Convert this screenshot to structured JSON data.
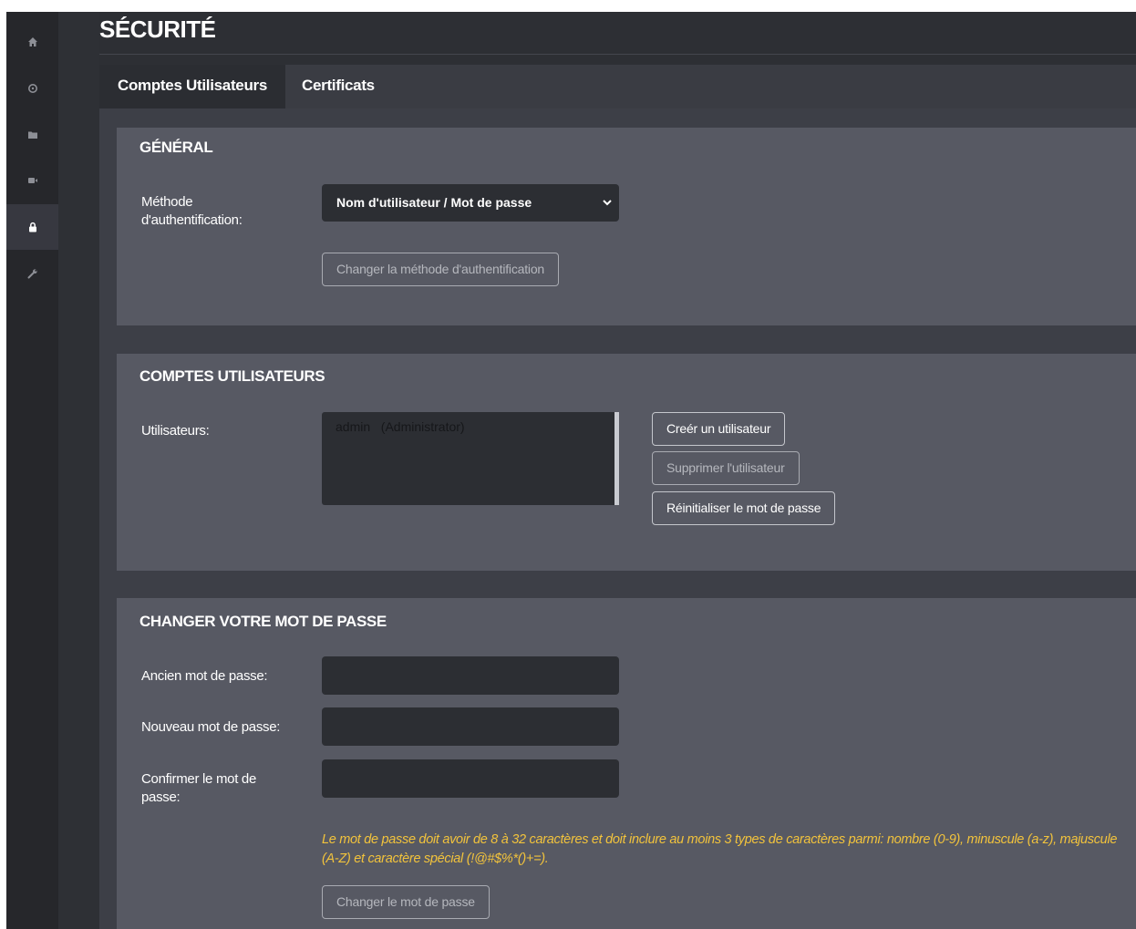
{
  "sidebar": {
    "items": [
      {
        "icon": "home-icon"
      },
      {
        "icon": "gear-icon"
      },
      {
        "icon": "folder-icon"
      },
      {
        "icon": "video-camera-icon"
      },
      {
        "icon": "lock-icon",
        "active": true
      },
      {
        "icon": "wrench-icon"
      }
    ]
  },
  "page": {
    "title": "SÉCURITÉ"
  },
  "tabs": [
    {
      "label": "Comptes Utilisateurs",
      "active": true
    },
    {
      "label": "Certificats",
      "active": false
    }
  ],
  "general": {
    "title": "GÉNÉRAL",
    "auth_label": "Méthode d'authentification:",
    "auth_value": "Nom d'utilisateur / Mot de passe",
    "change_auth_button": "Changer la méthode d'authentification"
  },
  "accounts": {
    "title": "COMPTES UTILISATEURS",
    "users_label": "Utilisateurs:",
    "users": [
      "admin   (Administrator)"
    ],
    "create_button": "Creér un utilisateur",
    "delete_button": "Supprimer l'utilisateur",
    "reset_button": "Réinitialiser le mot de passe"
  },
  "password": {
    "title": "CHANGER VOTRE MOT DE PASSE",
    "old_label": "Ancien mot de passe:",
    "new_label": "Nouveau mot de passe:",
    "confirm_label": "Confirmer le mot de passe:",
    "old_value": "",
    "new_value": "",
    "confirm_value": "",
    "hint": "Le mot de passe doit avoir de 8 à 32 caractères et doit inclure au moins 3 types de caractères parmi: nombre (0-9), minuscule (a-z), majuscule (A-Z) et caractère spécial (!@#$%*()+=).",
    "submit_button": "Changer le mot de passe"
  },
  "colors": {
    "accent_hint": "#f2c33c",
    "panel": "#575963",
    "sidebar": "#26272b"
  }
}
